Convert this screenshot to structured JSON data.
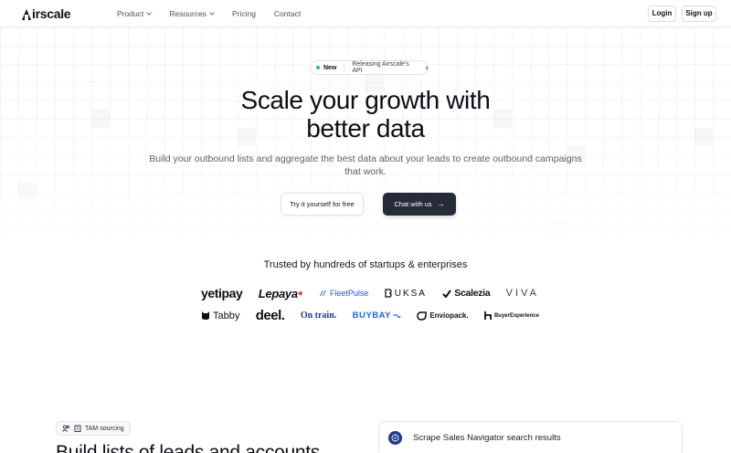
{
  "nav": {
    "logo": "irscale",
    "links": [
      {
        "label": "Product",
        "has_dropdown": true
      },
      {
        "label": "Resources",
        "has_dropdown": true
      },
      {
        "label": "Pricing",
        "has_dropdown": false
      },
      {
        "label": "Contact",
        "has_dropdown": false
      }
    ],
    "login_label": "Login",
    "signup_label": "Sign up"
  },
  "hero": {
    "badge_new": "New",
    "badge_text": "Releasing Airscale's API",
    "title_line1": "Scale your growth with",
    "title_line2": "better data",
    "subtitle": "Build your outbound lists and aggregate the best data about your leads to create outbound campaigns that work.",
    "try_label": "Try it yourself for free",
    "chat_label": "Chat with us"
  },
  "trusted": {
    "heading": "Trusted by hundreds of startups & enterprises",
    "logos_row1": [
      "yetipay",
      "Lepaya",
      "FleetPulse",
      "UKSA",
      "Scalezia",
      "VIVA"
    ],
    "logos_row2": [
      "Tabby",
      "deel.",
      "On train.",
      "BUYBAY",
      "Enviopack.",
      "BuyerExperience"
    ]
  },
  "features": {
    "tag": "TAM sourcing",
    "title": "Build lists of leads and accounts",
    "card_title": "Scrape Sales Navigator search results"
  },
  "colors": {
    "accent_dark": "#262b38",
    "new_dot": "#22c55e",
    "lepaya_dot": "#ef4444",
    "fleetpulse": "#2a55d6",
    "buybay": "#2563eb",
    "card_icon": "#1e3a8a"
  },
  "icons": {
    "pill_chevron": "chevron-right-icon",
    "chat_arrow": "arrow-right-icon",
    "tam": [
      "users-icon",
      "building-icon"
    ],
    "card": "compass-icon"
  }
}
